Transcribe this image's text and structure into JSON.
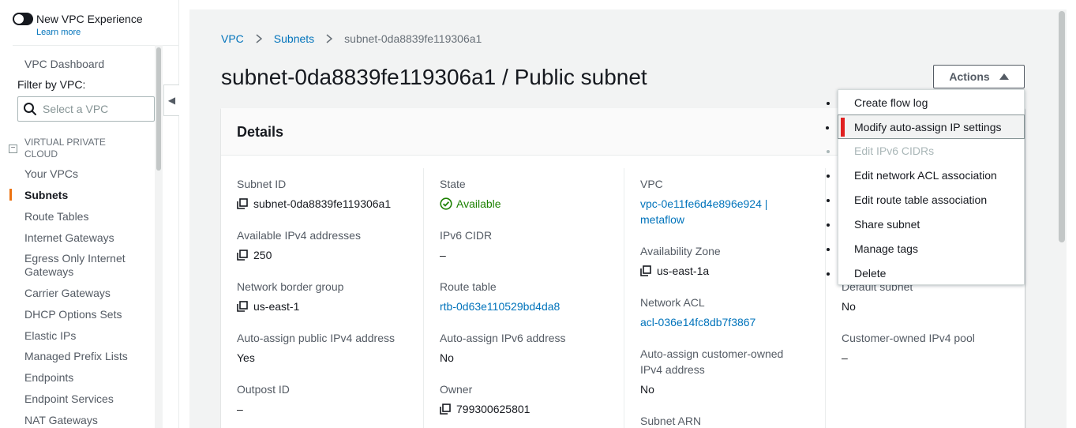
{
  "sidebar": {
    "toggle_label": "New VPC Experience",
    "learn_more": "Learn more",
    "dashboard": "VPC Dashboard",
    "filter_label": "Filter by VPC:",
    "filter_placeholder": "Select a VPC",
    "section_title": "VIRTUAL PRIVATE CLOUD",
    "collapse_symbol": "−",
    "items": [
      {
        "label": "Your VPCs"
      },
      {
        "label": "Subnets"
      },
      {
        "label": "Route Tables"
      },
      {
        "label": "Internet Gateways"
      },
      {
        "label": "Egress Only Internet Gateways"
      },
      {
        "label": "Carrier Gateways"
      },
      {
        "label": "DHCP Options Sets"
      },
      {
        "label": "Elastic IPs"
      },
      {
        "label": "Managed Prefix Lists"
      },
      {
        "label": "Endpoints"
      },
      {
        "label": "Endpoint Services"
      },
      {
        "label": "NAT Gateways"
      }
    ],
    "active_item": "Subnets",
    "accent_color": "#ec7211"
  },
  "collapse_handle": "◀",
  "breadcrumb": {
    "items": [
      "VPC",
      "Subnets"
    ],
    "current": "subnet-0da8839fe119306a1"
  },
  "page_title": "subnet-0da8839fe119306a1 / Public subnet",
  "actions": {
    "label": "Actions",
    "menu": [
      {
        "label": "Create flow log",
        "disabled": false
      },
      {
        "label": "Modify auto-assign IP settings",
        "disabled": false,
        "highlighted": true
      },
      {
        "label": "Edit IPv6 CIDRs",
        "disabled": true
      },
      {
        "label": "Edit network ACL association",
        "disabled": false
      },
      {
        "label": "Edit route table association",
        "disabled": false
      },
      {
        "label": "Share subnet",
        "disabled": false
      },
      {
        "label": "Manage tags",
        "disabled": false
      },
      {
        "label": "Delete",
        "disabled": false
      }
    ]
  },
  "details": {
    "title": "Details",
    "col1": {
      "subnet_id_label": "Subnet ID",
      "subnet_id": "subnet-0da8839fe119306a1",
      "avail_ipv4_label": "Available IPv4 addresses",
      "avail_ipv4": "250",
      "nbg_label": "Network border group",
      "nbg": "us-east-1",
      "auto_public_label": "Auto-assign public IPv4 address",
      "auto_public": "Yes",
      "outpost_label": "Outpost ID",
      "outpost": "–"
    },
    "col2": {
      "state_label": "State",
      "state": "Available",
      "ipv6_cidr_label": "IPv6 CIDR",
      "ipv6_cidr": "–",
      "route_table_label": "Route table",
      "route_table": "rtb-0d63e110529bd4da8",
      "auto_ipv6_label": "Auto-assign IPv6 address",
      "auto_ipv6": "No",
      "owner_label": "Owner",
      "owner": "799300625801"
    },
    "col3": {
      "vpc_label": "VPC",
      "vpc_line1": "vpc-0e11fe6d4e896e924 |",
      "vpc_line2": "metaflow",
      "az_label": "Availability Zone",
      "az": "us-east-1a",
      "nacl_label": "Network ACL",
      "nacl": "acl-036e14fc8db7f3867",
      "auto_cust_label_1": "Auto-assign customer-owned",
      "auto_cust_label_2": "IPv4 address",
      "auto_cust": "No",
      "arn_label": "Subnet ARN"
    },
    "col4": {
      "default_subnet_label": "Default subnet",
      "default_subnet": "No",
      "cust_pool_label": "Customer-owned IPv4 pool",
      "cust_pool": "–"
    }
  },
  "colors": {
    "link": "#0073bb",
    "ok": "#1d8102",
    "highlight_marker": "#e02020"
  }
}
